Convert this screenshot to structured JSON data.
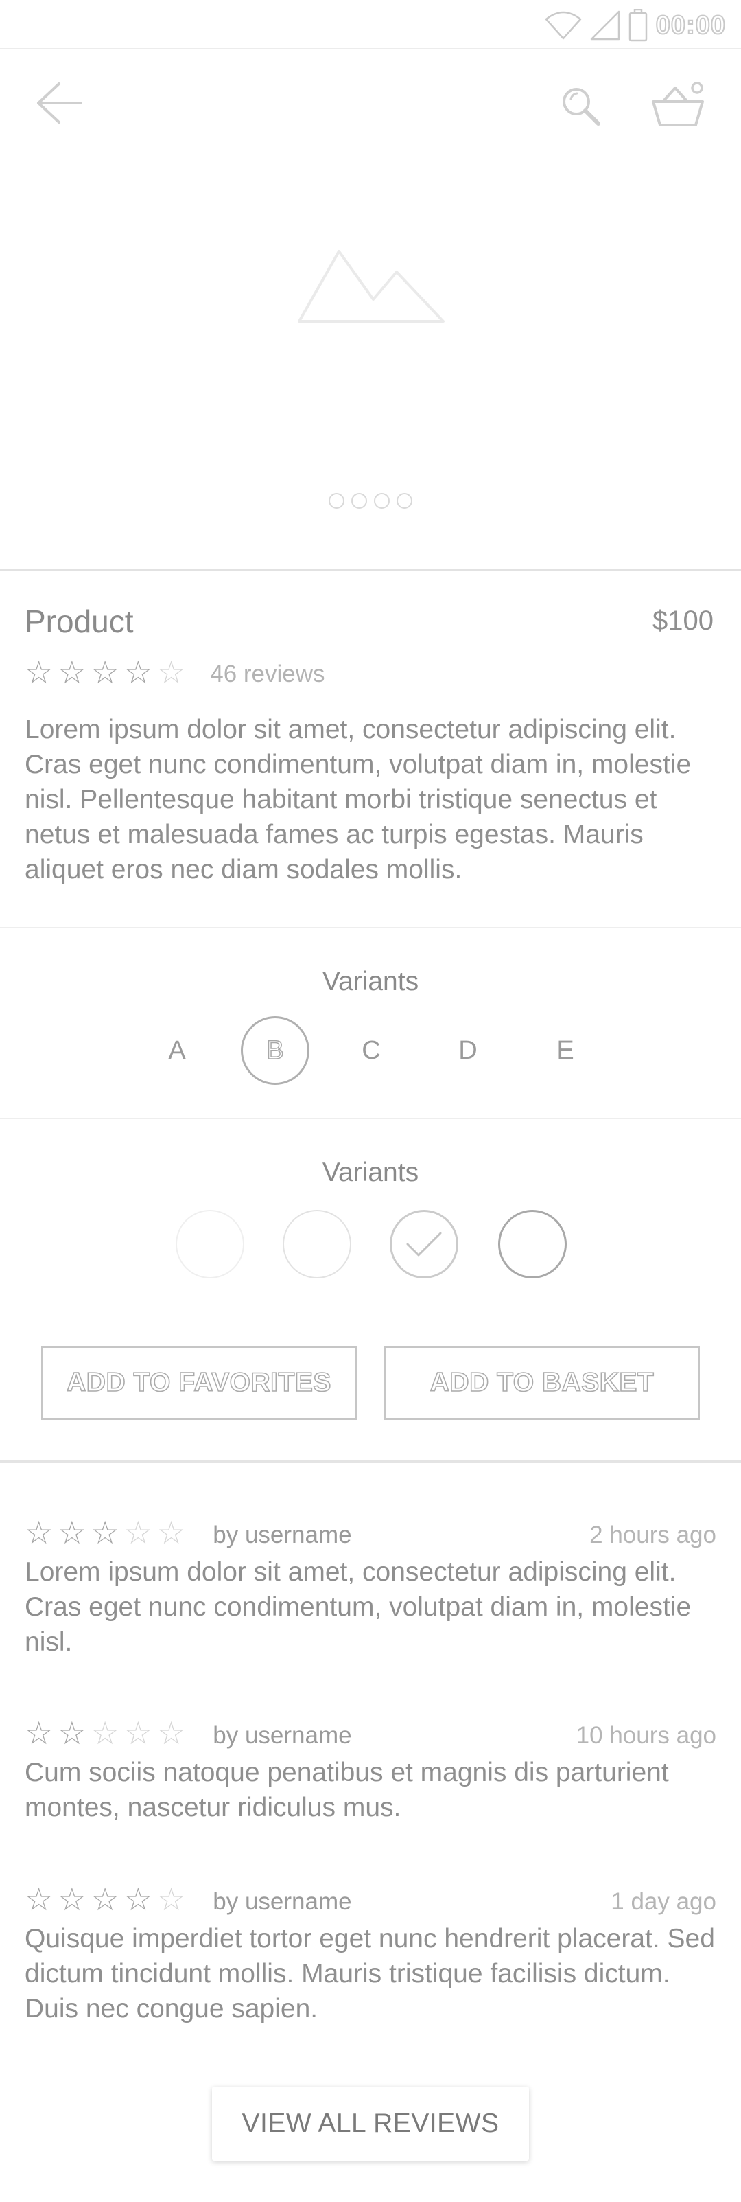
{
  "status_bar": {
    "time": "00:00"
  },
  "hero": {
    "slide_count": 4
  },
  "product": {
    "title": "Product",
    "price": "$100",
    "rating": 4,
    "rating_max": 5,
    "reviews_label": "46 reviews",
    "description": "Lorem ipsum dolor sit amet, consectetur adipiscing elit. Cras eget nunc condimentum, volutpat diam in, molestie nisl. Pellentesque habitant morbi tristique senectus et netus et malesuada fames ac turpis egestas. Mauris aliquet eros nec diam sodales mollis."
  },
  "variants_letters": {
    "title": "Variants",
    "options": [
      "A",
      "B",
      "C",
      "D",
      "E"
    ],
    "selected": "B"
  },
  "variants_colors": {
    "title": "Variants",
    "swatches": [
      "swatch-1",
      "swatch-2",
      "swatch-3",
      "swatch-4"
    ],
    "checked_index": 2
  },
  "actions": {
    "add_to_favorites": "ADD TO FAVORITES",
    "add_to_basket": "ADD TO BASKET"
  },
  "reviews": [
    {
      "stars": 3,
      "user": "by username",
      "time": "2 hours ago",
      "text": "Lorem ipsum dolor sit amet, consectetur adipiscing elit. Cras eget nunc condimentum, volutpat diam in, molestie nisl."
    },
    {
      "stars": 2,
      "user": "by username",
      "time": "10 hours ago",
      "text": "Cum sociis natoque penatibus et magnis dis parturient montes, nascetur ridiculus mus."
    },
    {
      "stars": 4,
      "user": "by username",
      "time": "1 day ago",
      "text": "Quisque imperdiet tortor eget nunc hendrerit placerat. Sed dictum tincidunt mollis. Mauris tristique facilisis dictum. Duis nec congue sapien."
    }
  ],
  "view_all_label": "VIEW ALL REVIEWS",
  "icons": {
    "back": "arrow-left-icon",
    "search": "search-icon",
    "basket": "basket-icon",
    "image_placeholder": "image-placeholder-icon",
    "wifi": "wifi-icon",
    "signal": "signal-icon",
    "battery": "battery-icon",
    "check": "check-icon"
  },
  "colors": {
    "line": "#eeeeee",
    "text": "#8f8f8f",
    "muted": "#b5b5b5"
  }
}
